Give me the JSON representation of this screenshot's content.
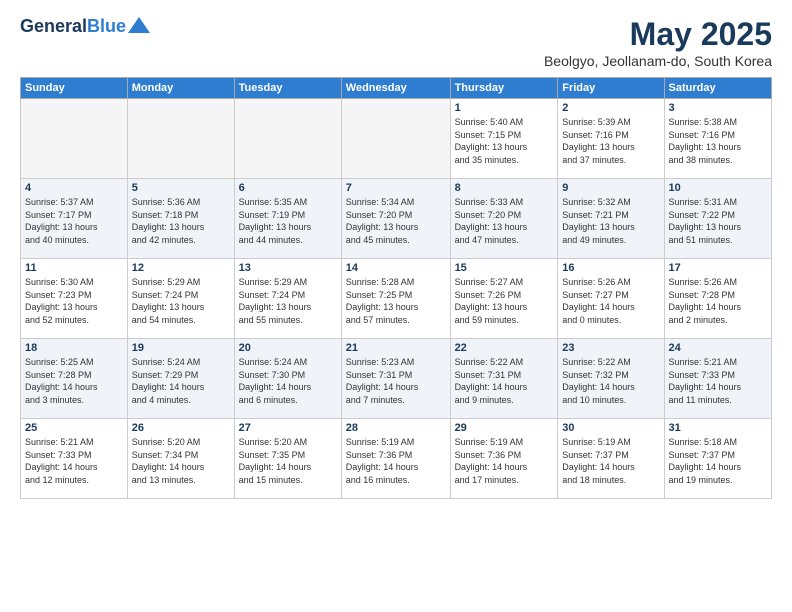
{
  "header": {
    "logo_general": "General",
    "logo_blue": "Blue",
    "month_title": "May 2025",
    "location": "Beolgyo, Jeollanam-do, South Korea"
  },
  "weekdays": [
    "Sunday",
    "Monday",
    "Tuesday",
    "Wednesday",
    "Thursday",
    "Friday",
    "Saturday"
  ],
  "weeks": [
    [
      {
        "day": "",
        "info": ""
      },
      {
        "day": "",
        "info": ""
      },
      {
        "day": "",
        "info": ""
      },
      {
        "day": "",
        "info": ""
      },
      {
        "day": "1",
        "info": "Sunrise: 5:40 AM\nSunset: 7:15 PM\nDaylight: 13 hours\nand 35 minutes."
      },
      {
        "day": "2",
        "info": "Sunrise: 5:39 AM\nSunset: 7:16 PM\nDaylight: 13 hours\nand 37 minutes."
      },
      {
        "day": "3",
        "info": "Sunrise: 5:38 AM\nSunset: 7:16 PM\nDaylight: 13 hours\nand 38 minutes."
      }
    ],
    [
      {
        "day": "4",
        "info": "Sunrise: 5:37 AM\nSunset: 7:17 PM\nDaylight: 13 hours\nand 40 minutes."
      },
      {
        "day": "5",
        "info": "Sunrise: 5:36 AM\nSunset: 7:18 PM\nDaylight: 13 hours\nand 42 minutes."
      },
      {
        "day": "6",
        "info": "Sunrise: 5:35 AM\nSunset: 7:19 PM\nDaylight: 13 hours\nand 44 minutes."
      },
      {
        "day": "7",
        "info": "Sunrise: 5:34 AM\nSunset: 7:20 PM\nDaylight: 13 hours\nand 45 minutes."
      },
      {
        "day": "8",
        "info": "Sunrise: 5:33 AM\nSunset: 7:20 PM\nDaylight: 13 hours\nand 47 minutes."
      },
      {
        "day": "9",
        "info": "Sunrise: 5:32 AM\nSunset: 7:21 PM\nDaylight: 13 hours\nand 49 minutes."
      },
      {
        "day": "10",
        "info": "Sunrise: 5:31 AM\nSunset: 7:22 PM\nDaylight: 13 hours\nand 51 minutes."
      }
    ],
    [
      {
        "day": "11",
        "info": "Sunrise: 5:30 AM\nSunset: 7:23 PM\nDaylight: 13 hours\nand 52 minutes."
      },
      {
        "day": "12",
        "info": "Sunrise: 5:29 AM\nSunset: 7:24 PM\nDaylight: 13 hours\nand 54 minutes."
      },
      {
        "day": "13",
        "info": "Sunrise: 5:29 AM\nSunset: 7:24 PM\nDaylight: 13 hours\nand 55 minutes."
      },
      {
        "day": "14",
        "info": "Sunrise: 5:28 AM\nSunset: 7:25 PM\nDaylight: 13 hours\nand 57 minutes."
      },
      {
        "day": "15",
        "info": "Sunrise: 5:27 AM\nSunset: 7:26 PM\nDaylight: 13 hours\nand 59 minutes."
      },
      {
        "day": "16",
        "info": "Sunrise: 5:26 AM\nSunset: 7:27 PM\nDaylight: 14 hours\nand 0 minutes."
      },
      {
        "day": "17",
        "info": "Sunrise: 5:26 AM\nSunset: 7:28 PM\nDaylight: 14 hours\nand 2 minutes."
      }
    ],
    [
      {
        "day": "18",
        "info": "Sunrise: 5:25 AM\nSunset: 7:28 PM\nDaylight: 14 hours\nand 3 minutes."
      },
      {
        "day": "19",
        "info": "Sunrise: 5:24 AM\nSunset: 7:29 PM\nDaylight: 14 hours\nand 4 minutes."
      },
      {
        "day": "20",
        "info": "Sunrise: 5:24 AM\nSunset: 7:30 PM\nDaylight: 14 hours\nand 6 minutes."
      },
      {
        "day": "21",
        "info": "Sunrise: 5:23 AM\nSunset: 7:31 PM\nDaylight: 14 hours\nand 7 minutes."
      },
      {
        "day": "22",
        "info": "Sunrise: 5:22 AM\nSunset: 7:31 PM\nDaylight: 14 hours\nand 9 minutes."
      },
      {
        "day": "23",
        "info": "Sunrise: 5:22 AM\nSunset: 7:32 PM\nDaylight: 14 hours\nand 10 minutes."
      },
      {
        "day": "24",
        "info": "Sunrise: 5:21 AM\nSunset: 7:33 PM\nDaylight: 14 hours\nand 11 minutes."
      }
    ],
    [
      {
        "day": "25",
        "info": "Sunrise: 5:21 AM\nSunset: 7:33 PM\nDaylight: 14 hours\nand 12 minutes."
      },
      {
        "day": "26",
        "info": "Sunrise: 5:20 AM\nSunset: 7:34 PM\nDaylight: 14 hours\nand 13 minutes."
      },
      {
        "day": "27",
        "info": "Sunrise: 5:20 AM\nSunset: 7:35 PM\nDaylight: 14 hours\nand 15 minutes."
      },
      {
        "day": "28",
        "info": "Sunrise: 5:19 AM\nSunset: 7:36 PM\nDaylight: 14 hours\nand 16 minutes."
      },
      {
        "day": "29",
        "info": "Sunrise: 5:19 AM\nSunset: 7:36 PM\nDaylight: 14 hours\nand 17 minutes."
      },
      {
        "day": "30",
        "info": "Sunrise: 5:19 AM\nSunset: 7:37 PM\nDaylight: 14 hours\nand 18 minutes."
      },
      {
        "day": "31",
        "info": "Sunrise: 5:18 AM\nSunset: 7:37 PM\nDaylight: 14 hours\nand 19 minutes."
      }
    ]
  ]
}
